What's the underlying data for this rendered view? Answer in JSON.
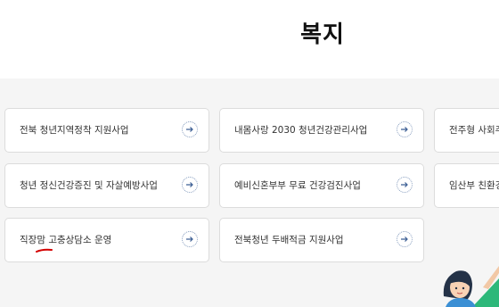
{
  "page": {
    "title": "복지"
  },
  "cards": [
    {
      "label": "전북 청년지역정착 지원사업"
    },
    {
      "label": "내몸사랑 2030 청년건강관리사업"
    },
    {
      "label": "전주형 사회주"
    },
    {
      "label": "청년 정신건강증진 및 자살예방사업"
    },
    {
      "label": "예비신혼부부 무료 건강검진사업"
    },
    {
      "label": "임산부 친환경"
    },
    {
      "label": "직장맘 고충상담소 운영"
    },
    {
      "label": "전북청년 두배적금 지원사업"
    }
  ],
  "icons": {
    "card_arrow": "arrow-right-icon"
  },
  "colors": {
    "annotation": "#d40000",
    "accent_green": "#2db87a",
    "background": "#f5f5f5"
  }
}
